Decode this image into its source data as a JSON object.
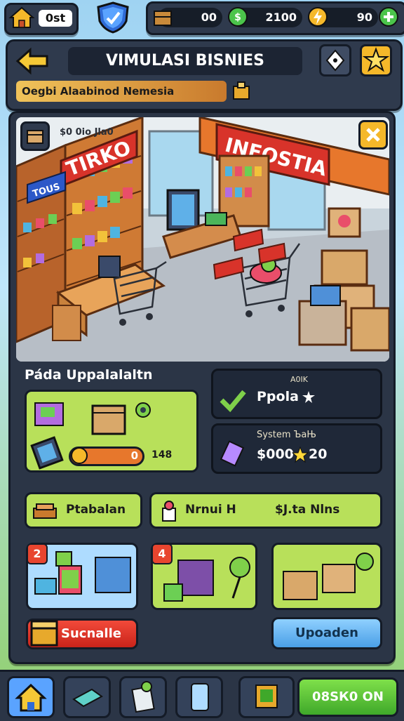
{
  "topbar": {
    "home_value": "0st",
    "resources": [
      {
        "name": "crate",
        "value": "00"
      },
      {
        "name": "cash",
        "value": "2100"
      },
      {
        "name": "energy",
        "value": "90"
      }
    ]
  },
  "header": {
    "title": "VIMULASI BISNIES",
    "subtitle": "Oegbi Alaabinod Nemesia"
  },
  "scene": {
    "top_label": "$0 0io Jla0",
    "sign_left": "TIRKO",
    "sign_small": "TOUS",
    "sign_store": "INFOSTIA"
  },
  "left_panel": {
    "heading": "Páda Uppalalaltn",
    "progress_value": "0",
    "progress_extra": "148"
  },
  "cards": {
    "status_label": "A0IK",
    "status_value": "Ppola",
    "system_label": "System ЪaЊ",
    "system_value": "$000",
    "system_count": "20"
  },
  "tabs": {
    "left_label": "Ptabalan",
    "right_label": "Nrnui H",
    "right_value": "$J.ta Nlns"
  },
  "items": [
    {
      "badge": "2"
    },
    {
      "badge": "4"
    },
    {
      "badge": ""
    }
  ],
  "actions": {
    "red_label": "Sucnalle",
    "blue_label": "Upoaden"
  },
  "bottomnav": {
    "cta_label": "08SК0 ON"
  },
  "colors": {
    "accent_lime": "#b8e05a",
    "panel_dark": "#2f3a4d",
    "button_red": "#e8452f",
    "button_blue": "#4a9fe6",
    "button_green": "#3fa82a",
    "store_orange": "#e7772c"
  }
}
